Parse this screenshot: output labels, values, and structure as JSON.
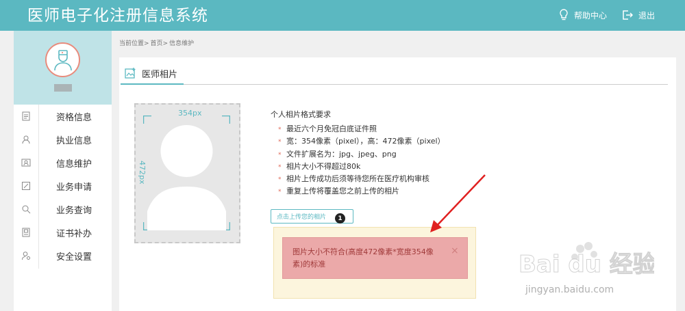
{
  "header": {
    "title": "医师电子化注册信息系统",
    "help_label": "帮助中心",
    "logout_label": "退出",
    "bg_color": "#5bb8c1"
  },
  "sidebar": {
    "username": "",
    "items": [
      {
        "label": "资格信息",
        "icon": "document-icon"
      },
      {
        "label": "执业信息",
        "icon": "person-icon"
      },
      {
        "label": "信息维护",
        "icon": "id-card-icon"
      },
      {
        "label": "业务申请",
        "icon": "edit-form-icon"
      },
      {
        "label": "业务查询",
        "icon": "search-icon"
      },
      {
        "label": "证书补办",
        "icon": "certificate-icon"
      },
      {
        "label": "安全设置",
        "icon": "user-lock-icon"
      }
    ]
  },
  "breadcrumb": {
    "prefix": "当前位置>",
    "home": "首页>",
    "current": "信息维护"
  },
  "section": {
    "title": "医师相片",
    "icon": "photo-icon"
  },
  "photo_placeholder": {
    "width_label": "354px",
    "height_label": "472px"
  },
  "requirements": {
    "title": "个人相片格式要求",
    "items": [
      "最近六个月免冠白底证件照",
      "宽：354像素（pixel），高：472像素（pixel）",
      "文件扩展名为：jpg、jpeg、png",
      "相片大小不得超过80k",
      "相片上传成功后须等待您所在医疗机构审核",
      "重复上传将覆盖您之前上传的相片"
    ]
  },
  "upload": {
    "label": "点击上传您的相片",
    "badge": "1"
  },
  "alert": {
    "message": "图片大小不符合(高度472像素*宽度354像素)的标准",
    "close": "×"
  },
  "watermark": {
    "brand": "Bai du 经验",
    "url": "jingyan.baidu.com"
  }
}
